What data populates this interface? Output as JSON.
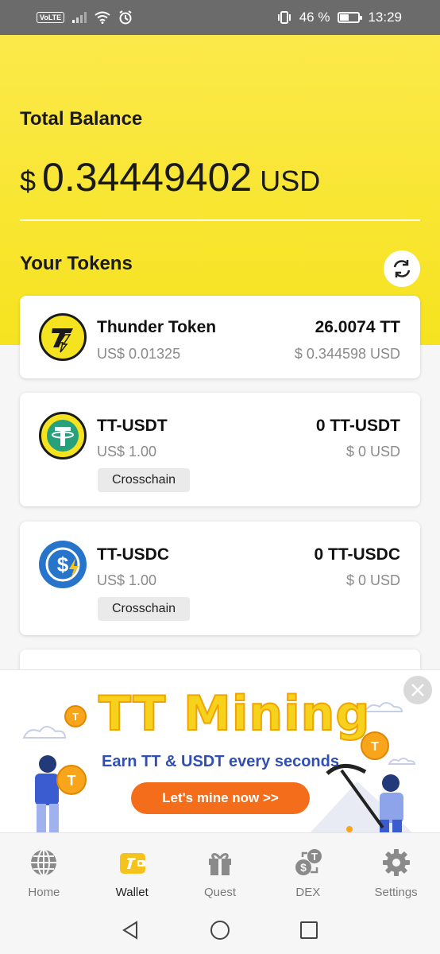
{
  "status_bar": {
    "network_badge": "VoLTE",
    "battery_percent": "46 %",
    "battery_level": 0.46,
    "time": "13:29"
  },
  "wallet": {
    "total_label": "Total Balance",
    "balance_symbol": "$",
    "balance_value": "0.34449402",
    "balance_currency": "USD",
    "tokens_label": "Your Tokens"
  },
  "tokens": [
    {
      "name": "Thunder Token",
      "price": "US$ 0.01325",
      "amount": "26.0074 TT",
      "value": "$ 0.344598 USD",
      "icon": "thunder-token-icon"
    },
    {
      "name": "TT-USDT",
      "price": "US$ 1.00",
      "amount": "0 TT-USDT",
      "value": "$ 0 USD",
      "tag": "Crosschain",
      "icon": "tether-icon"
    },
    {
      "name": "TT-USDC",
      "price": "US$ 1.00",
      "amount": "0 TT-USDC",
      "value": "$ 0 USD",
      "tag": "Crosschain",
      "icon": "usdc-icon"
    }
  ],
  "banner": {
    "title": "TT Mining",
    "subtitle": "Earn TT & USDT every seconds",
    "cta": "Let's mine now >>"
  },
  "nav": [
    {
      "label": "Home",
      "icon": "globe-icon"
    },
    {
      "label": "Wallet",
      "icon": "wallet-icon",
      "active": true
    },
    {
      "label": "Quest",
      "icon": "gift-icon"
    },
    {
      "label": "DEX",
      "icon": "swap-icon"
    },
    {
      "label": "Settings",
      "icon": "gear-icon"
    }
  ],
  "colors": {
    "accent": "#f6e31f",
    "cta": "#f46d1a",
    "brand_blue": "#2f4fb5"
  }
}
